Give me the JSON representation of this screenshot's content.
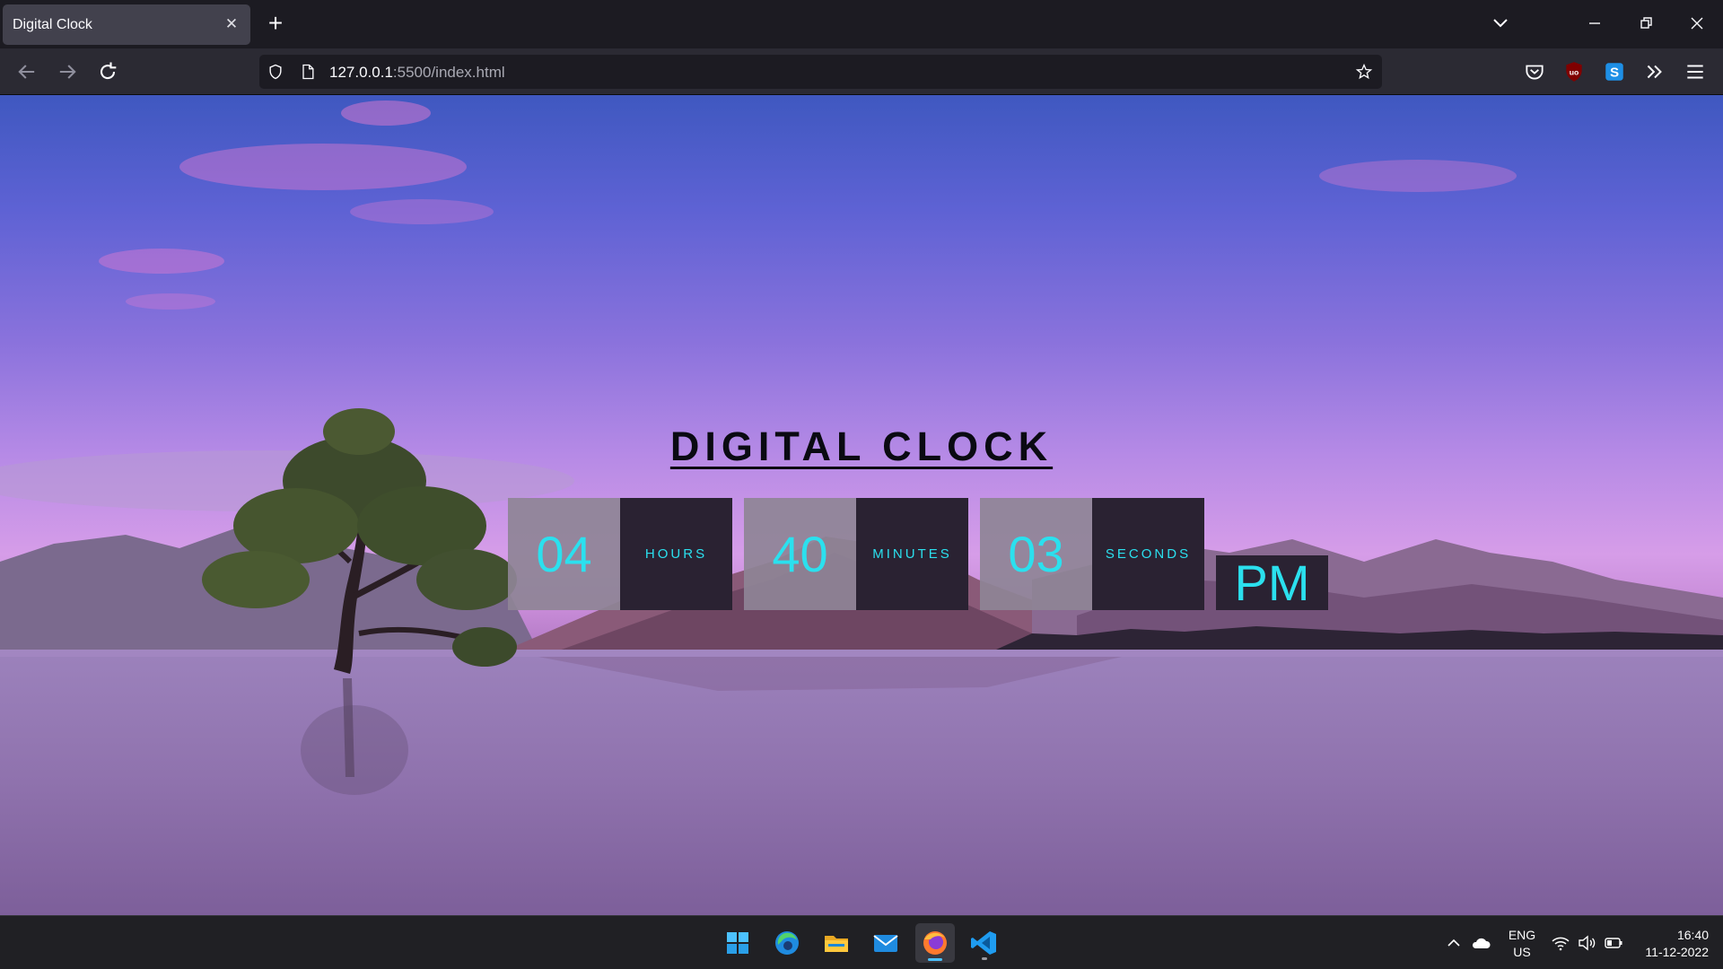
{
  "browser": {
    "tab_title": "Digital Clock",
    "url_host": "127.0.0.1",
    "url_path": ":5500/index.html"
  },
  "page": {
    "title": "DIGITAL CLOCK",
    "hours": "04",
    "hours_label": "HOURS",
    "minutes": "40",
    "minutes_label": "MINUTES",
    "seconds": "03",
    "seconds_label": "SECONDS",
    "ampm": "PM",
    "accent_color": "#2be0ee"
  },
  "taskbar": {
    "apps": [
      "windows-start",
      "edge",
      "file-explorer",
      "mail",
      "firefox",
      "vscode"
    ],
    "lang_line1": "ENG",
    "lang_line2": "US",
    "time": "16:40",
    "date": "11-12-2022"
  }
}
